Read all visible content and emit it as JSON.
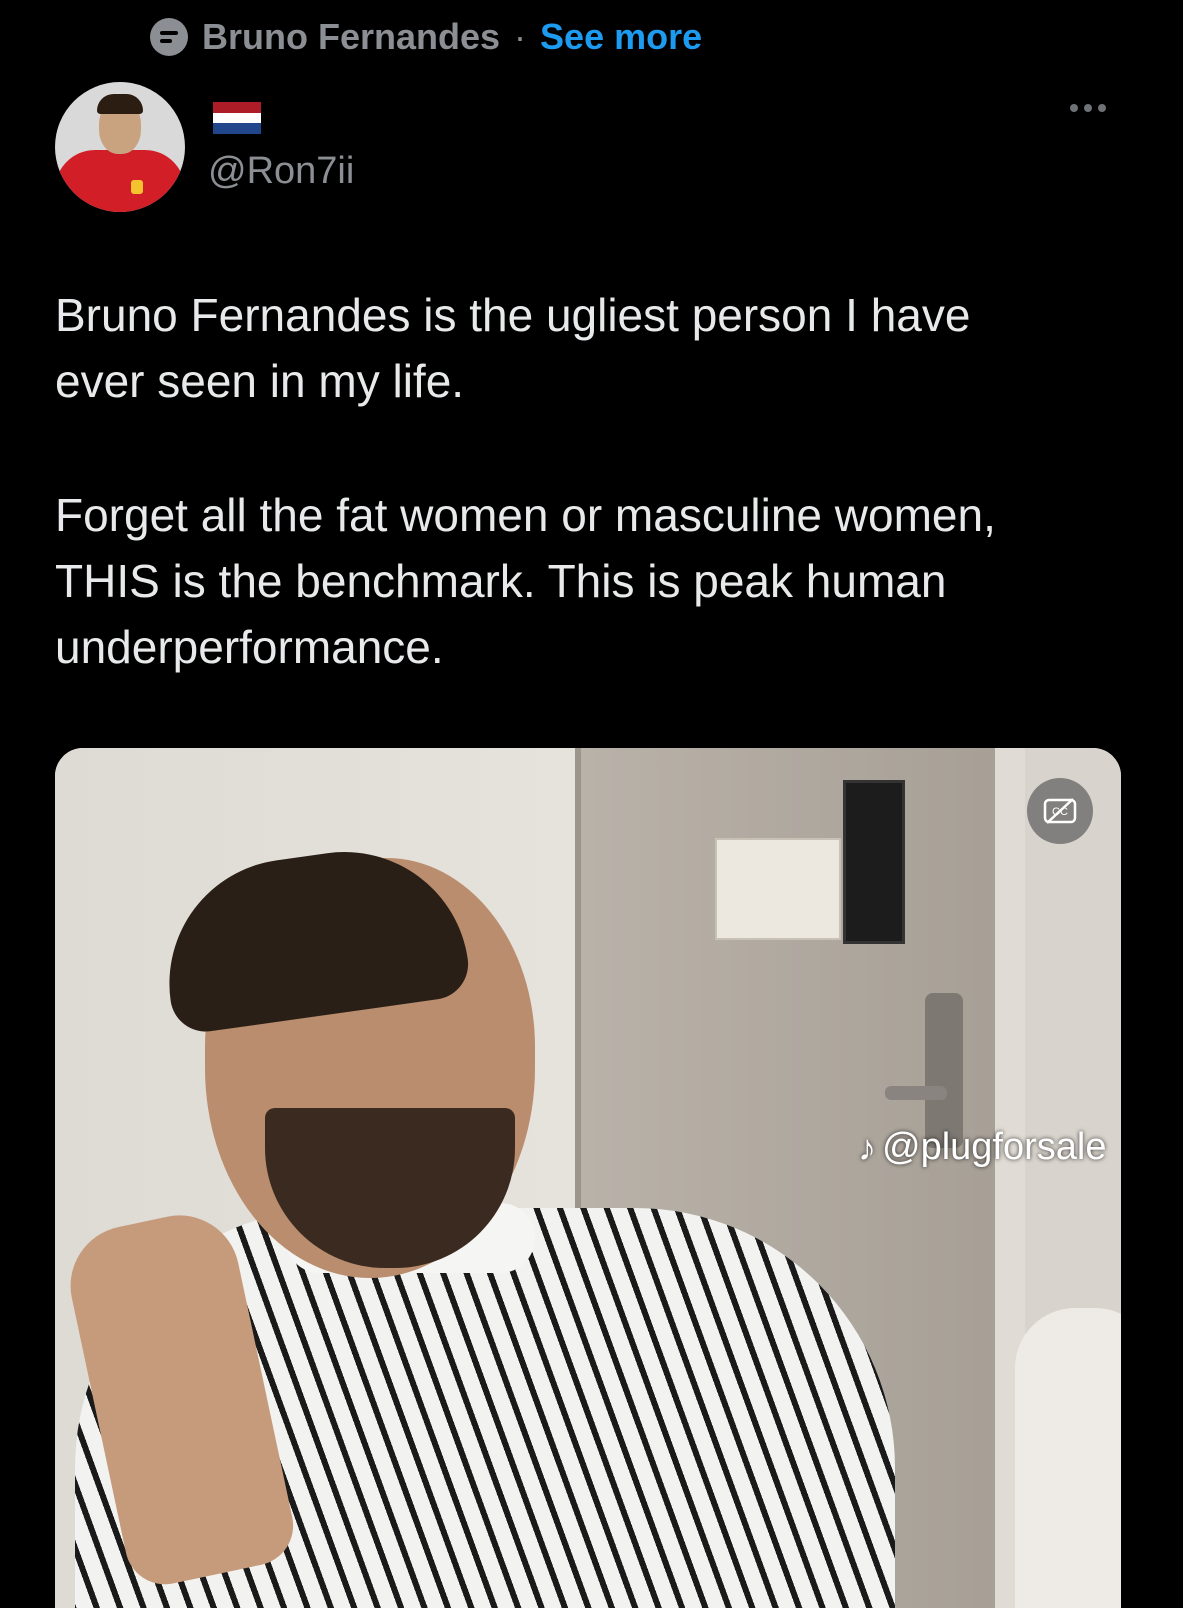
{
  "context": {
    "name": "Bruno Fernandes",
    "separator": "·",
    "link": "See more"
  },
  "header": {
    "handle": "@Ron7ii",
    "flag": [
      "#ae1c28",
      "#ffffff",
      "#21468b"
    ]
  },
  "tweet": {
    "paragraphs": [
      "Bruno Fernandes is the ugliest person I have\never seen in my life.",
      "Forget all the fat women or masculine women,\nTHIS is the benchmark. This is peak human\nunderperformance."
    ]
  },
  "media": {
    "watermark": "@plugforsale"
  },
  "colors": {
    "background": "#000000",
    "accent": "#1d9bf0",
    "secondary_text": "#8b8f94"
  }
}
